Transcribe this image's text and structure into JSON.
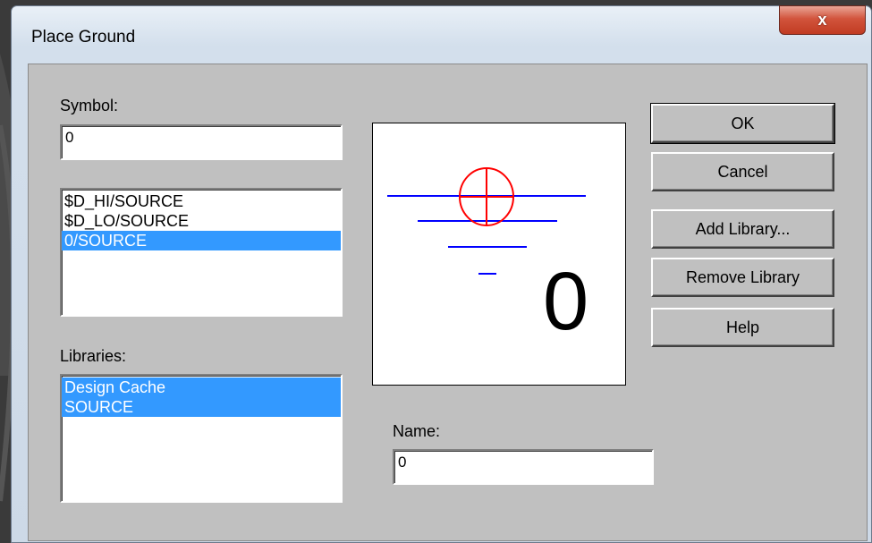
{
  "window": {
    "title": "Place Ground",
    "close_glyph": "x"
  },
  "symbol": {
    "label": "Symbol:",
    "value": "0"
  },
  "symbol_list": {
    "items": [
      "$D_HI/SOURCE",
      "$D_LO/SOURCE",
      "0/SOURCE"
    ],
    "selected_index": 2
  },
  "libraries": {
    "label": "Libraries:",
    "items": [
      "Design Cache",
      "SOURCE"
    ],
    "selected": [
      0,
      1
    ]
  },
  "preview": {
    "symbol_text": "0",
    "accent_line_color": "#0000ff",
    "origin_marker_color": "#ff0000"
  },
  "name": {
    "label": "Name:",
    "value": "0"
  },
  "buttons": {
    "ok": "OK",
    "cancel": "Cancel",
    "add_library": "Add Library...",
    "remove_library": "Remove Library",
    "help": "Help"
  }
}
